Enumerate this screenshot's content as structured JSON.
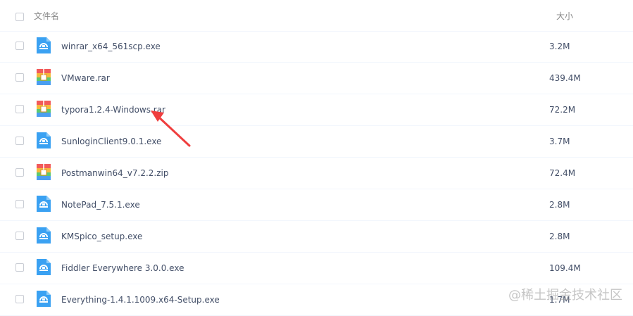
{
  "header": {
    "name_label": "文件名",
    "size_label": "大小"
  },
  "files": [
    {
      "name": "winrar_x64_561scp.exe",
      "size": "3.2M",
      "type": "exe"
    },
    {
      "name": "VMware.rar",
      "size": "439.4M",
      "type": "archive"
    },
    {
      "name": "typora1.2.4-Windows.rar",
      "size": "72.2M",
      "type": "archive"
    },
    {
      "name": "SunloginClient9.0.1.exe",
      "size": "3.7M",
      "type": "exe"
    },
    {
      "name": "Postmanwin64_v7.2.2.zip",
      "size": "72.4M",
      "type": "archive"
    },
    {
      "name": "NotePad_7.5.1.exe",
      "size": "2.8M",
      "type": "exe"
    },
    {
      "name": "KMSpico_setup.exe",
      "size": "2.8M",
      "type": "exe"
    },
    {
      "name": "Fiddler Everywhere 3.0.0.exe",
      "size": "109.4M",
      "type": "exe"
    },
    {
      "name": "Everything-1.4.1.1009.x64-Setup.exe",
      "size": "1.7M",
      "type": "exe"
    }
  ],
  "icons": {
    "exe": "exe-file-icon",
    "archive": "archive-file-icon"
  },
  "colors": {
    "exe_icon": "#3aa1f2",
    "annotation_arrow": "#ef3e3e"
  },
  "watermark": "@稀土掘金技术社区"
}
